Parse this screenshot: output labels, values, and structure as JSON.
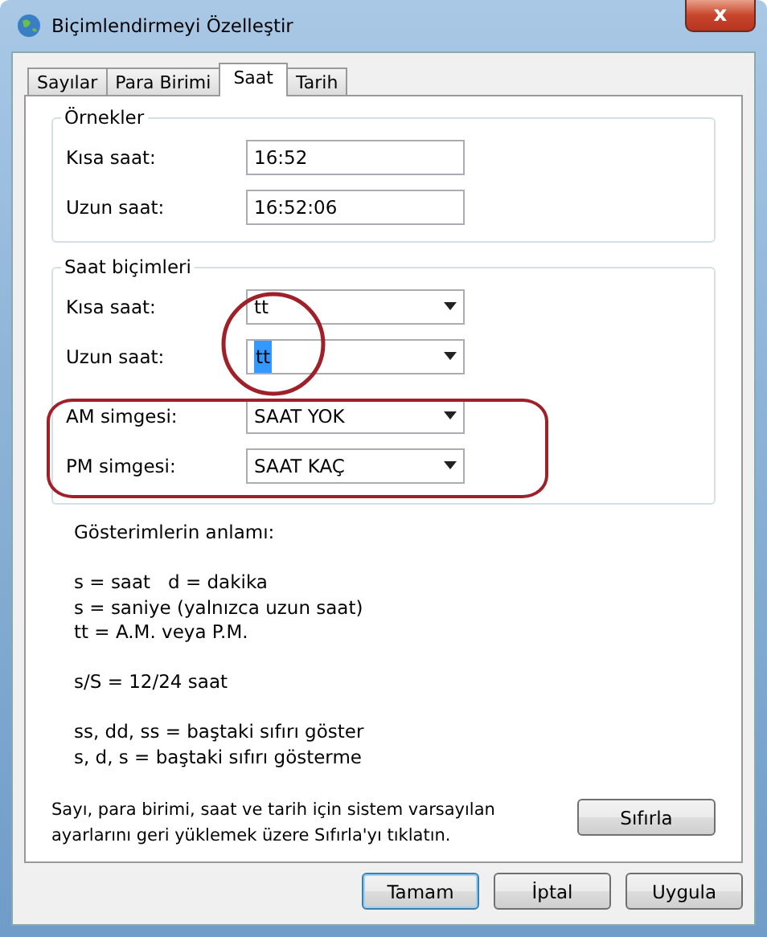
{
  "window": {
    "title": "Biçimlendirmeyi Özelleştir",
    "close": "x"
  },
  "tabs": [
    {
      "label": "Sayılar",
      "selected": false
    },
    {
      "label": "Para Birimi",
      "selected": false
    },
    {
      "label": "Saat",
      "selected": true
    },
    {
      "label": "Tarih",
      "selected": false
    }
  ],
  "examples": {
    "title": "Örnekler",
    "rows": [
      {
        "label": "Kısa saat:",
        "value": "16:52"
      },
      {
        "label": "Uzun saat:",
        "value": "16:52:06"
      }
    ]
  },
  "formats": {
    "title": "Saat biçimleri",
    "rows": [
      {
        "label": "Kısa saat:",
        "value": "tt",
        "text_selected": false
      },
      {
        "label": "Uzun saat:",
        "value": "tt",
        "text_selected": true
      },
      {
        "label": "AM simgesi:",
        "value": "SAAT YOK",
        "text_selected": false
      },
      {
        "label": "PM simgesi:",
        "value": "SAAT KAÇ",
        "text_selected": false
      }
    ]
  },
  "legend": {
    "title": "Gösterimlerin anlamı:",
    "groups": [
      [
        "s = saat   d = dakika",
        "s = saniye (yalnızca uzun saat)",
        "tt = A.M. veya P.M."
      ],
      [
        "s/S = 12/24 saat"
      ],
      [
        "ss, dd, ss = baştaki sıfırı göster",
        "s, d, s = baştaki sıfırı gösterme"
      ]
    ]
  },
  "reset": {
    "text": "Sayı, para birimi, saat ve tarih için sistem varsayılan ayarlarını geri yüklemek üzere Sıfırla'yı tıklatın.",
    "button": "Sıfırla"
  },
  "buttons": [
    {
      "label": "Tamam",
      "default": true
    },
    {
      "label": "İptal",
      "default": false
    },
    {
      "label": "Uygula",
      "default": false
    }
  ]
}
